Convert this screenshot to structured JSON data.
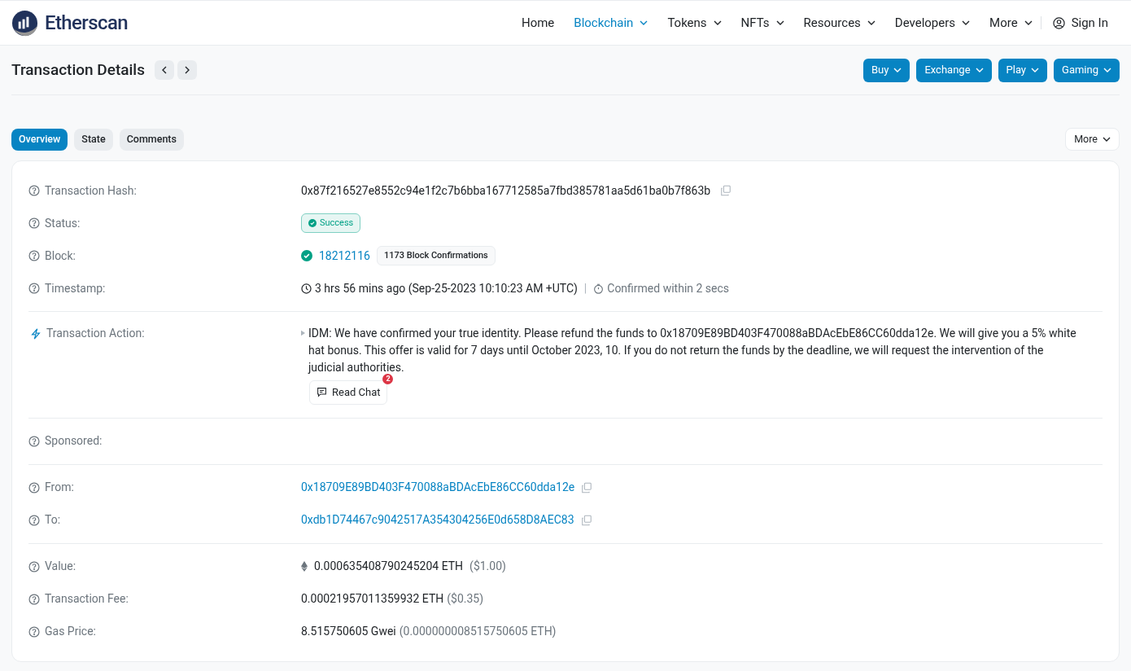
{
  "nav": {
    "logo": "Etherscan",
    "items": [
      {
        "label": "Home",
        "selected": false,
        "dropdown": false
      },
      {
        "label": "Blockchain",
        "selected": true,
        "dropdown": true
      },
      {
        "label": "Tokens",
        "selected": false,
        "dropdown": true
      },
      {
        "label": "NFTs",
        "selected": false,
        "dropdown": true
      },
      {
        "label": "Resources",
        "selected": false,
        "dropdown": true
      },
      {
        "label": "Developers",
        "selected": false,
        "dropdown": true
      },
      {
        "label": "More",
        "selected": false,
        "dropdown": true
      }
    ],
    "sign_in": "Sign In"
  },
  "page": {
    "title": "Transaction Details",
    "header_buttons": [
      "Buy",
      "Exchange",
      "Play",
      "Gaming"
    ]
  },
  "tabs": [
    {
      "label": "Overview",
      "selected": true
    },
    {
      "label": "State",
      "selected": false
    },
    {
      "label": "Comments",
      "selected": false
    }
  ],
  "more_button": "More",
  "sections": [
    [
      {
        "kind": "hash",
        "label": "Transaction Hash:",
        "value": "0x87f216527e8552c94e1f2c7b6bba167712585a7fbd385781aa5d61ba0b7f863b"
      },
      {
        "kind": "status",
        "label": "Status:",
        "value": "Success"
      },
      {
        "kind": "block",
        "label": "Block:",
        "value": "18212116",
        "badge": "1173 Block Confirmations"
      },
      {
        "kind": "timestamp",
        "label": "Timestamp:",
        "value": "3 hrs 56 mins ago (Sep-25-2023 10:10:23 AM +UTC)",
        "separator": "|",
        "confirmed": "Confirmed within 2 secs"
      }
    ],
    [
      {
        "kind": "action",
        "label": "Transaction Action:",
        "value": "IDM: We have confirmed your true identity. Please refund the funds to 0x18709E89BD403F470088aBDAcEbE86CC60dda12e. We will give you a 5% white hat bonus. This offer is valid for 7 days until October 2023, 10. If you do not return the funds by the deadline, we will request the intervention of the judicial authorities.",
        "button": "Read Chat",
        "count": "2"
      }
    ],
    [
      {
        "kind": "empty",
        "label": "Sponsored:"
      }
    ],
    [
      {
        "kind": "address",
        "label": "From:",
        "value": "0x18709E89BD403F470088aBDAcEbE86CC60dda12e"
      },
      {
        "kind": "address",
        "label": "To:",
        "value": "0xdb1D74467c9042517A354304256E0d658D8AEC83"
      }
    ],
    [
      {
        "kind": "value",
        "label": "Value:",
        "value": "0.000635408790245204 ETH",
        "fiat": "($1.00)"
      },
      {
        "kind": "amount",
        "label": "Transaction Fee:",
        "value": "0.00021957011359932 ETH",
        "fiat": "($0.35)"
      },
      {
        "kind": "amount",
        "label": "Gas Price:",
        "value": "8.515750605 Gwei",
        "fiat": "(0.000000008515750605 ETH)"
      }
    ]
  ]
}
